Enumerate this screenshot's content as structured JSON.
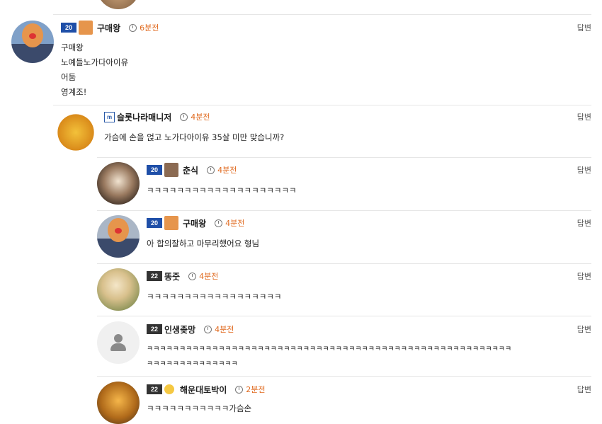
{
  "reply_label": "답변",
  "comments": [
    {
      "nick": "구매왕",
      "time": "6분전",
      "level": "20",
      "lines": [
        "구매왕",
        "노예들노가다아이유",
        "어둠",
        "영계조!"
      ]
    },
    {
      "nick": "슬롯나라매니저",
      "time": "4분전",
      "level": "m",
      "lines": [
        "가슴에 손을 얹고 노가다아이유 35살 미만 맞습니까?"
      ]
    },
    {
      "nick": "춘식",
      "time": "4분전",
      "level": "20",
      "lines": [
        "ㅋㅋㅋㅋㅋㅋㅋㅋㅋㅋㅋㅋㅋㅋㅋㅋㅋㅋㅋㅋ"
      ]
    },
    {
      "nick": "구매왕",
      "time": "4분전",
      "level": "20",
      "lines": [
        "아 합의잘하고 마무리했어요 형님"
      ]
    },
    {
      "nick": "똥줏",
      "time": "4분전",
      "level": "22",
      "lines": [
        "ㅋㅋㅋㅋㅋㅋㅋㅋㅋㅋㅋㅋㅋㅋㅋㅋㅋㅋ"
      ]
    },
    {
      "nick": "인생좆망",
      "time": "4분전",
      "level": "22",
      "lines": [
        "ㅋㅋㅋㅋㅋㅋㅋㅋㅋㅋㅋㅋㅋㅋㅋㅋㅋㅋㅋㅋㅋㅋㅋㅋㅋㅋㅋㅋㅋㅋㅋㅋㅋㅋㅋㅋㅋㅋㅋㅋㅋㅋㅋㅋㅋㅋㅋㅋㅋㅋㅋㅋㅋㅋㅋㅋ",
        "ㅋㅋㅋㅋㅋㅋㅋㅋㅋㅋㅋㅋㅋㅋ"
      ]
    },
    {
      "nick": "해운대토박이",
      "time": "2분전",
      "level": "22",
      "lines": [
        "ㅋㅋㅋㅋㅋㅋㅋㅋㅋㅋㅋ가슴손"
      ]
    }
  ],
  "icons": {
    "time": "clock-icon",
    "default_avatar": "user-silhouette-icon"
  },
  "colors": {
    "time": "#e06a1f",
    "level_blue": "#1f4fa8",
    "level_dark": "#333333"
  }
}
